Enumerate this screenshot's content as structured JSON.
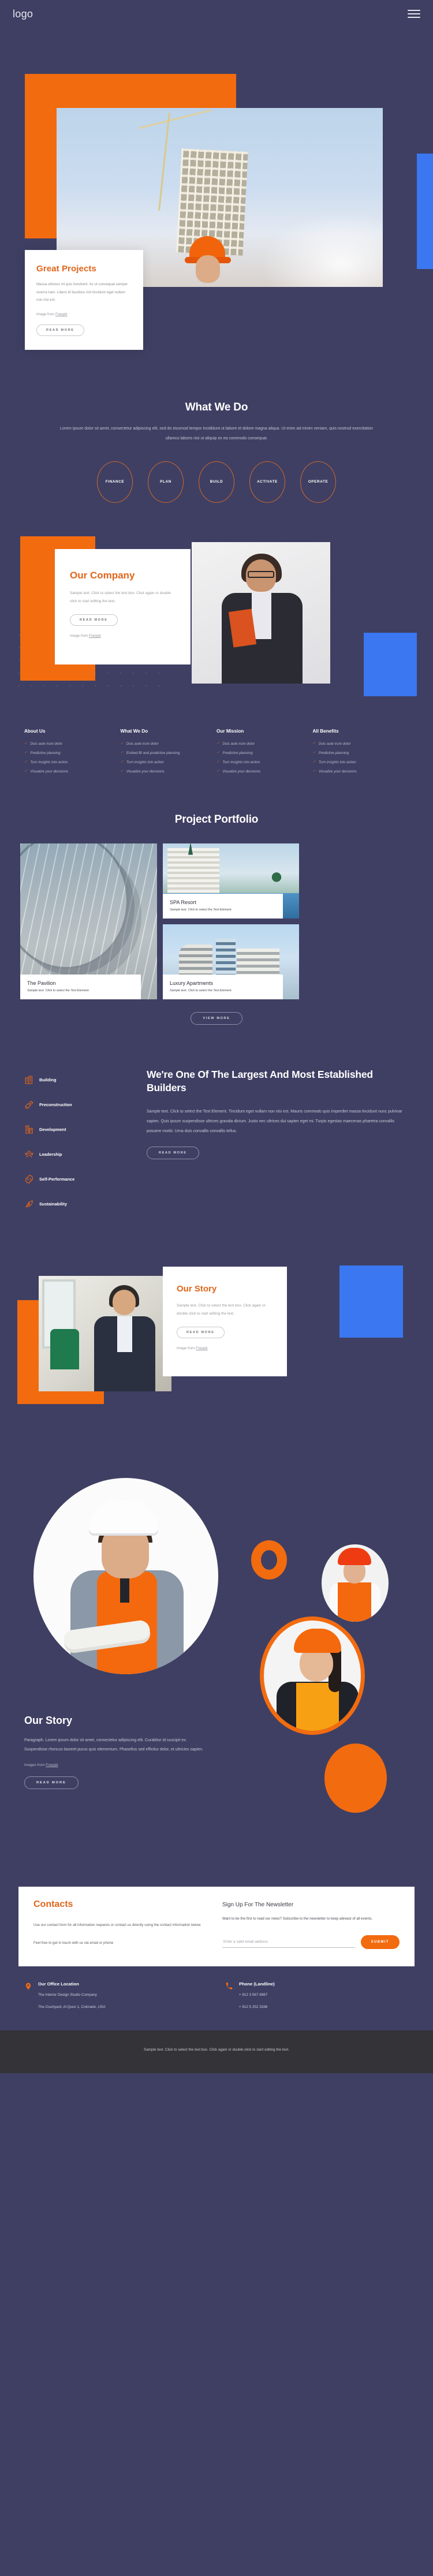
{
  "header": {
    "logo": "logo",
    "menu_icon": "hamburger-menu-icon"
  },
  "hero": {
    "title": "Great Projects",
    "body": "Massa ultricies mi quis hendrerit. Ac ut consequat semper viverra nam. Libero id faucibus nisl tincidunt eget nullam non nisi est.",
    "credit_prefix": "Image from ",
    "credit_link": "Freepik",
    "cta": "READ MORE"
  },
  "whatwedo": {
    "title": "What We Do",
    "subtitle": "Lorem ipsum dolor sit amet, consectetur adipiscing elit, sed do eiusmod tempor incididunt ut labore et dolore magna aliqua. Ut enim ad minim veniam, quis nostrud exercitation ullamco laboris nisi ut aliquip ex ea commodo consequat.",
    "steps": [
      "FINANCE",
      "PLAN",
      "BUILD",
      "ACTIVATE",
      "OPERATE"
    ]
  },
  "company": {
    "title": "Our Company",
    "body": "Sample text. Click to select the text box. Click again or double click to start editing the text.",
    "cta": "READ MORE",
    "credit_prefix": "Image from ",
    "credit_link": "Freepik"
  },
  "linkcols": [
    {
      "title": "About Us",
      "items": [
        "Duis aute irure dolor",
        "Predictive planning",
        "Turn insights into action",
        "Visualize your decisions"
      ]
    },
    {
      "title": "What We Do",
      "items": [
        "Duis aute irure dolor",
        "Embed BI and predictive planning",
        "Turn insights into action",
        "Visualize your decisions"
      ]
    },
    {
      "title": "Our Mission",
      "items": [
        "Duis aute irure dolor",
        "Predictive planning",
        "Turn insights into action",
        "Visualize your decisions"
      ]
    },
    {
      "title": "All Benefits",
      "items": [
        "Duis aute irure dolor",
        "Predictive planning",
        "Turn insights into action",
        "Visualize your decisions"
      ]
    }
  ],
  "portfolio": {
    "title": "Project Portfolio",
    "cards": [
      {
        "name": "The Pavilion",
        "caption": "Sample text. Click to select the Text Element."
      },
      {
        "name": "SPA Resort",
        "caption": "Sample text. Click to select the Text Element."
      },
      {
        "name": "Luxury Apartments",
        "caption": "Sample text. Click to select the Text Element."
      }
    ],
    "cta": "VIEW MORE"
  },
  "builders": {
    "features": [
      {
        "label": "Building",
        "icon": "building-icon"
      },
      {
        "label": "Preconstruction",
        "icon": "trowel-icon"
      },
      {
        "label": "Development",
        "icon": "skyscraper-icon"
      },
      {
        "label": "Leadership",
        "icon": "people-icon"
      },
      {
        "label": "Self-Performance",
        "icon": "code-gear-icon"
      },
      {
        "label": "Sustainability",
        "icon": "leaf-bolt-icon"
      }
    ],
    "title": "We're One Of The Largest And Most Established Builders",
    "body": "Sample text. Click to select the Text Element. Tincidunt eget nullam non nisi est. Mauris commodo quis imperdiet massa tincidunt nunc pulvinar sapien. Quis ipsum suspendisse ultrices gravida dictum. Justo nec ultrices dui sapien eget mi. Turpis egestas maecenas pharetra convallis posuere morbi. Urna duis convallis convallis tellus.",
    "cta": "READ MORE"
  },
  "story_card": {
    "title": "Our Story",
    "body": "Sample text. Click to select the text box. Click again or double click to start editing the text.",
    "cta": "READ MORE",
    "credit_prefix": "Image from ",
    "credit_link": "Freepik"
  },
  "story_section": {
    "title": "Our Story",
    "body": "Paragraph. Lorem ipsum dolor sit amet, consectetur adipiscing elit. Curabitur id suscipit ex. Suspendisse rhoncus laoreet purus quis elementum. Phasellus sed efficitur dolor, et ultricies sapien.",
    "credit_prefix": "Images from ",
    "credit_link": "Freepik",
    "cta": "READ MORE"
  },
  "contacts": {
    "title": "Contacts",
    "body1": "Use our contact form for all information requests or contact us directly using the contact information below.",
    "body2": "Feel free to get in touch with us via email or phone",
    "newsletter_title": "Sign Up For The Newsletter",
    "newsletter_body": "Want to be the first to read our news? Subscribe to the newsletter to keep abreast of all events.",
    "email_placeholder": "Enter a valid email address",
    "email_value": "",
    "submit": "SUBMIT"
  },
  "contact_info": [
    {
      "icon": "location-pin-icon",
      "title": "Our Office Location",
      "line1": "The Interior Design Studio Company",
      "line2": "The Courtyard, Al Quoz 1, Colorado,  USA"
    },
    {
      "icon": "phone-icon",
      "title": "Phone (Landline)",
      "line1": "+ 912 3 567 8987",
      "line2": "+ 912 5 252 3336"
    }
  ],
  "footer": {
    "text": "Sample text. Click to select the text box. Click again or double click to start editing the text."
  },
  "colors": {
    "background": "#3f3f63",
    "orange": "#f26b0f",
    "orange_text": "#e0651a",
    "blue": "#3a77f0",
    "footer_bg": "#333338"
  }
}
